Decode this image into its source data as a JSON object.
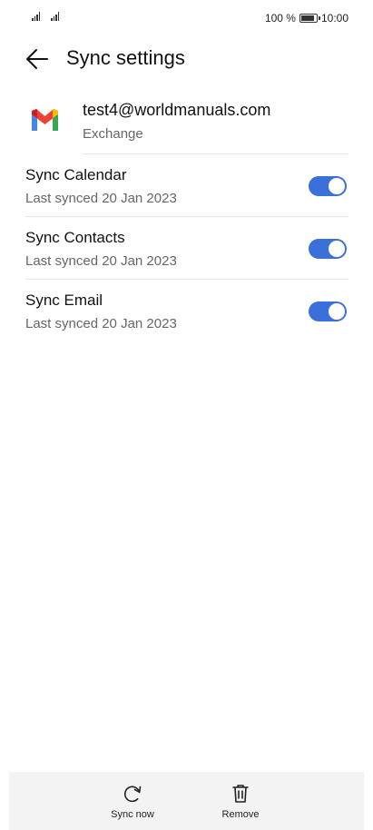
{
  "status_bar": {
    "battery": "100 %",
    "battery_level": 1.0,
    "time": "10:00"
  },
  "header": {
    "back_icon": "arrow-left-icon",
    "title": "Sync settings"
  },
  "account": {
    "icon": "gmail-icon",
    "email": "test4@worldmanuals.com",
    "type": "Exchange"
  },
  "sync_items": [
    {
      "title": "Sync Calendar",
      "subtitle": "Last synced 20 Jan 2023",
      "enabled": true
    },
    {
      "title": "Sync Contacts",
      "subtitle": "Last synced 20 Jan 2023",
      "enabled": true
    },
    {
      "title": "Sync Email",
      "subtitle": "Last synced 20 Jan 2023",
      "enabled": true
    }
  ],
  "bottom_bar": {
    "sync_now_label": "Sync now",
    "sync_now_icon": "refresh-icon",
    "remove_label": "Remove",
    "remove_icon": "trash-icon"
  },
  "colors": {
    "toggle_on": "#3b6fd9",
    "gmail_red": "#ea4335",
    "gmail_blue": "#4285f4",
    "gmail_green": "#34a853",
    "gmail_yellow": "#fbbc04",
    "gmail_dark_red": "#c5221f"
  }
}
